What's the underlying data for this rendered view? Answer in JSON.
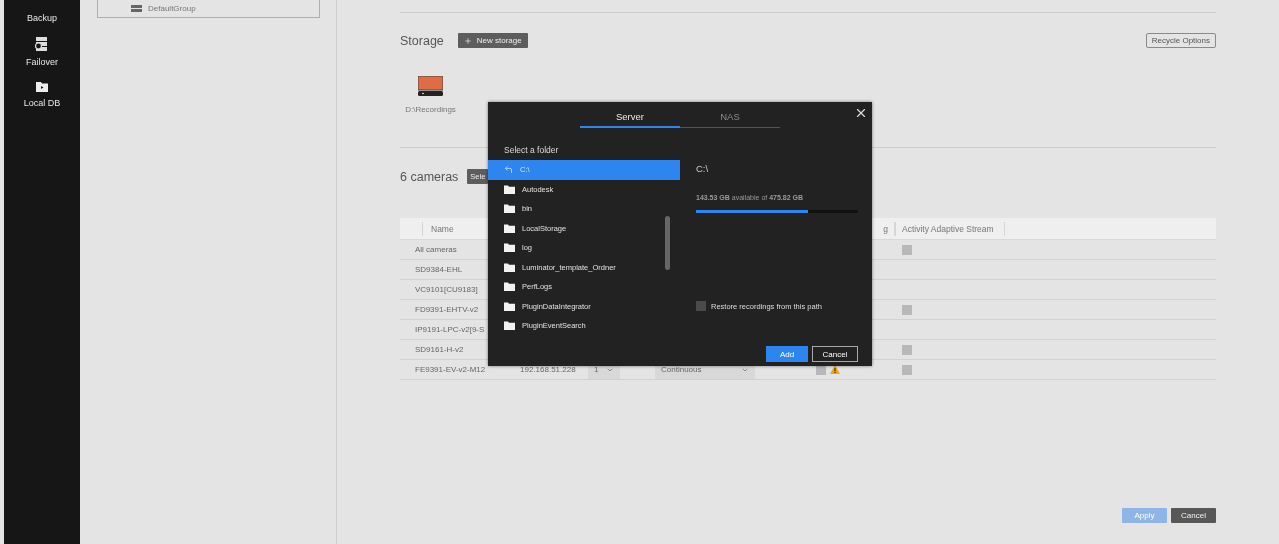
{
  "sidebar": {
    "items": [
      {
        "label": "Backup",
        "kind": "plain"
      },
      {
        "label": "Failover",
        "kind": "server"
      },
      {
        "label": "Local DB",
        "kind": "folder"
      }
    ]
  },
  "groups": [
    {
      "label": "DefaultGroup"
    }
  ],
  "storage": {
    "title": "Storage",
    "new_button": "New storage",
    "recycle_button": "Recycle Options",
    "items": [
      {
        "label": "D:\\Recordings"
      }
    ]
  },
  "cameras": {
    "title": "6 cameras",
    "select_button": "Sele"
  },
  "table": {
    "header": {
      "name": "Name",
      "column_5": "g",
      "activity": "Activity Adaptive Stream"
    },
    "rows": [
      {
        "name": "All cameras",
        "activity": {
          "checked": false
        }
      },
      {
        "name": "SD9384-EHL"
      },
      {
        "name": "VC9101[CU9183]"
      },
      {
        "name": "FD9391-EHTV-v2",
        "activity": {
          "checked": false
        }
      },
      {
        "name": "IP9191-LPC-v2[9-S"
      },
      {
        "name": "SD9161-H-v2",
        "activity": {
          "checked": false
        }
      },
      {
        "name": "FE9391-EV-v2-M12",
        "ip": "192.168.51.228",
        "stream": "1",
        "mode": "Continuous",
        "recording": {
          "checked": false,
          "warning": true
        },
        "activity": {
          "checked": false
        }
      }
    ]
  },
  "footer": {
    "buttons": [
      {
        "label": "Apply",
        "kind": "primary",
        "disabled": true
      },
      {
        "label": "Cancel",
        "kind": "dark",
        "disabled": false
      }
    ]
  },
  "dialog": {
    "tabs": [
      {
        "label": "Server",
        "selected": true
      },
      {
        "label": "NAS",
        "selected": false
      }
    ],
    "prompt": "Select a folder",
    "folders": [
      {
        "label": "C:\\",
        "kind": "up",
        "selected": true
      },
      {
        "label": "Autodesk",
        "kind": "folder",
        "selected": false
      },
      {
        "label": "bin",
        "kind": "folder",
        "selected": false
      },
      {
        "label": "LocalStorage",
        "kind": "folder",
        "selected": false
      },
      {
        "label": "log",
        "kind": "folder",
        "selected": false
      },
      {
        "label": "Luminator_template_Ordner",
        "kind": "folder",
        "selected": false
      },
      {
        "label": "PerfLogs",
        "kind": "folder",
        "selected": false
      },
      {
        "label": "PluginDataIntegrator",
        "kind": "folder",
        "selected": false
      },
      {
        "label": "PluginEventSearch",
        "kind": "folder",
        "selected": false
      }
    ],
    "path": "C:\\",
    "capacity": "**143.53 GB** available of **475.82 GB**",
    "usage": {
      "level": 0.69
    },
    "restore": {
      "label": "Restore recordings from this path",
      "checked": false
    },
    "buttons": [
      {
        "label": "Add",
        "kind": "primary"
      },
      {
        "label": "Cancel",
        "kind": "outline"
      }
    ]
  }
}
